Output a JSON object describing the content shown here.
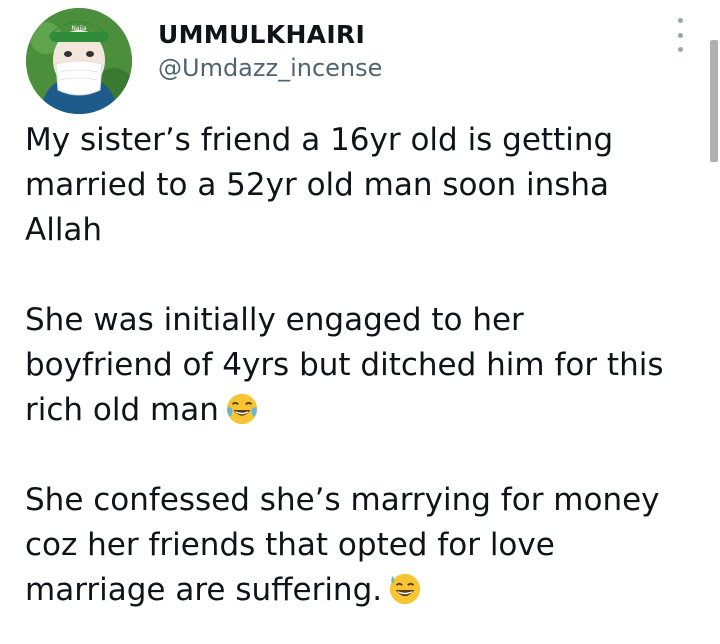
{
  "user": {
    "name": "UMMULKHAIRI",
    "handle": "@Umdazz_incense",
    "avatar_icon": "profile-photo-avatar"
  },
  "menu": {
    "icon": "more-vertical-icon"
  },
  "tweet": {
    "paragraphs": [
      {
        "text": "My sister’s friend a 16yr old is getting\nmarried to a 52yr old man soon insha\nAllah",
        "emoji": ""
      },
      {
        "text": "She was initially engaged to her\nboyfriend of 4yrs but ditched him for this\nrich old man",
        "emoji": "tears-of-joy-emoji"
      },
      {
        "text": "She confessed she’s marrying for money\ncoz her friends that opted for love\nmarriage are suffering.",
        "emoji": "grinning-sweat-emoji"
      }
    ]
  },
  "colors": {
    "text": "#0f1419",
    "muted": "#536471",
    "avatar_bg": "#4b8f3c"
  }
}
